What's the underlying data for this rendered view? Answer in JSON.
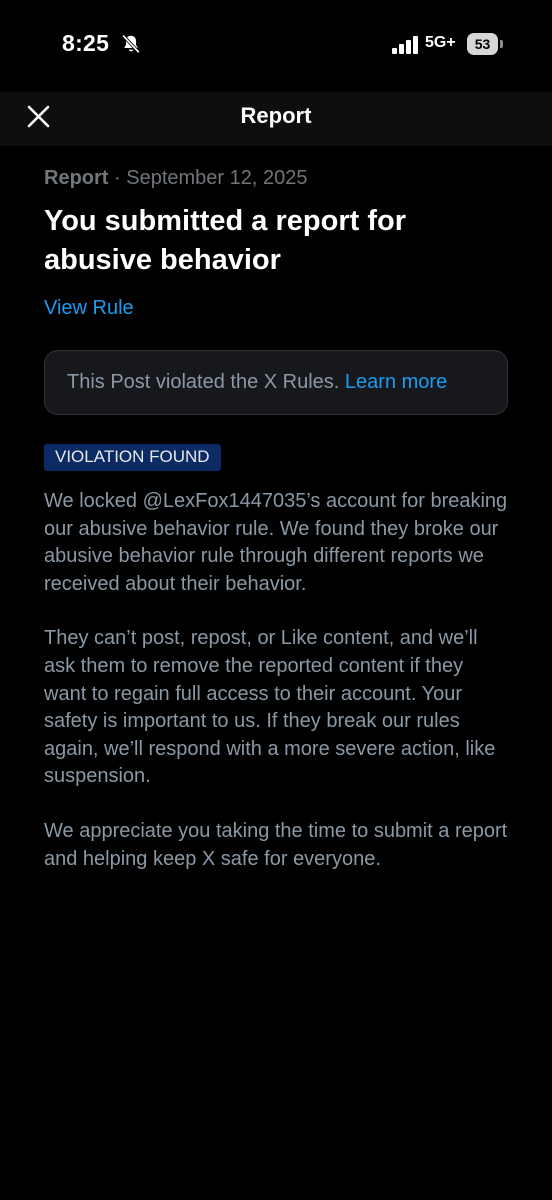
{
  "status_bar": {
    "time": "8:25",
    "network": "5G+",
    "battery": "53"
  },
  "nav": {
    "title": "Report"
  },
  "report": {
    "type": "Report",
    "separator": " · ",
    "date": "September 12, 2025",
    "headline": "You submitted a report for abusive behavior",
    "view_rule": "View Rule",
    "notice_text": "This Post violated the X Rules.",
    "notice_link": "Learn more",
    "badge": "VIOLATION FOUND",
    "paragraphs": [
      "We locked @LexFox1447035’s account for breaking our abusive behavior rule. We found they broke our abusive behavior rule through different reports we received about their behavior.",
      "They can’t post, repost, or Like content, and we’ll ask them to remove the reported content if they want to regain full access to their account. Your safety is important to us. If they break our rules again, we’ll respond with a more severe action, like suspension.",
      "We appreciate you taking the time to submit a report and helping keep X safe for everyone."
    ]
  },
  "colors": {
    "background": "#000000",
    "link": "#1d9bf0",
    "badge_bg": "#0c2a63",
    "muted_text": "#8b98a5"
  },
  "icons": [
    "bell-slash-icon",
    "cellular-signal-icon",
    "battery-icon",
    "close-icon"
  ]
}
